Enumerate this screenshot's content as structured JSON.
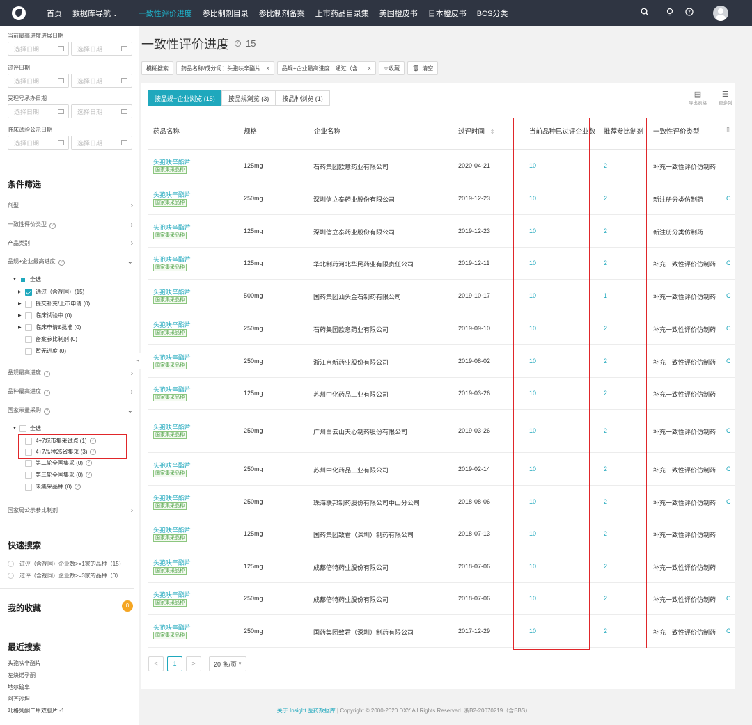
{
  "nav": {
    "items": [
      "首页",
      "数据库导航",
      "一致性评价进度",
      "参比制剂目录",
      "参比制剂备案",
      "上市药品目录集",
      "美国橙皮书",
      "日本橙皮书",
      "BCS分类"
    ],
    "active_index": 2,
    "dropdown_index": 1,
    "dropdown_caret": "⌄"
  },
  "sidebar": {
    "date_filters": [
      {
        "label": "当前最高进度进展日期",
        "start": "选择日期",
        "end": "选择日期"
      },
      {
        "label": "过评日期",
        "start": "选择日期",
        "end": "选择日期"
      },
      {
        "label": "受理号承办日期",
        "start": "选择日期",
        "end": "选择日期"
      },
      {
        "label": "临床试验公示日期",
        "start": "选择日期",
        "end": "选择日期"
      }
    ],
    "condition_title": "条件筛选",
    "filters": [
      {
        "label": "剂型"
      },
      {
        "label": "一致性评价类型"
      },
      {
        "label": "产品类别"
      },
      {
        "label": "品规+企业最高进度"
      }
    ],
    "progress_tree": {
      "all": "全选",
      "items": [
        "通过（含视同）(15)",
        "提交补充/上市申请 (0)",
        "临床试验中 (0)",
        "临床申请&批准 (0)",
        "备案参比制剂 (0)",
        "暂无进度 (0)"
      ]
    },
    "filters2": [
      {
        "label": "品规最高进度"
      },
      {
        "label": "品种最高进度"
      },
      {
        "label": "国家带量采购"
      }
    ],
    "procurement_tree": {
      "all": "全选",
      "items": [
        "4+7城市集采试点 (1)",
        "4+7品种25省集采 (3)",
        "第二轮全国集采 (0)",
        "第三轮全国集采 (0)",
        "未集采品种 (0)"
      ]
    },
    "filter_last": "国家局公示参比制剂",
    "quick_title": "快速搜索",
    "quick_items": [
      "过评（含视同）企业数>=1家的品种（15）",
      "过评（含视同）企业数>=3家的品种（0）"
    ],
    "fav_title": "我的收藏",
    "fav_count": "0",
    "recent_title": "最近搜索",
    "recent_items": [
      "头孢呋辛酯片",
      "左炔诺孕酮",
      "地尔硫卓",
      "阿齐沙坦",
      "吡格列酮二甲双胍片 -1"
    ]
  },
  "main": {
    "title": "一致性评价进度",
    "count": "15",
    "tags": {
      "fuzzy": "模糊搜索",
      "name": "药品名称/成分词：头孢呋辛酯片",
      "progress": "品规+企业最高进度：通过（含...",
      "save": "☆收藏",
      "clear": "清空"
    },
    "tabs": [
      "按品规+企业浏览 (15)",
      "按品规浏览 (3)",
      "按品种浏览 (1)"
    ],
    "tools": {
      "export": "导出表格",
      "more": "更多列"
    },
    "columns": [
      "药品名称",
      "规格",
      "企业名称",
      "过评时间",
      "当前品种已过评企业数",
      "推荐参比制剂",
      "一致性评价类型"
    ],
    "sort_icon": "⇕",
    "drug_tag": "国家集采品种",
    "rows": [
      {
        "name": "头孢呋辛酯片",
        "spec": "125mg",
        "company": "石药集团欧意药业有限公司",
        "date": "2020-04-21",
        "count": "10",
        "ref": "2",
        "type": "补充一致性评价仿制药"
      },
      {
        "name": "头孢呋辛酯片",
        "spec": "250mg",
        "company": "深圳信立泰药业股份有限公司",
        "date": "2019-12-23",
        "count": "10",
        "ref": "2",
        "type": "新注册分类仿制药"
      },
      {
        "name": "头孢呋辛酯片",
        "spec": "125mg",
        "company": "深圳信立泰药业股份有限公司",
        "date": "2019-12-23",
        "count": "10",
        "ref": "2",
        "type": "新注册分类仿制药"
      },
      {
        "name": "头孢呋辛酯片",
        "spec": "125mg",
        "company": "华北制药河北华民药业有限责任公司",
        "date": "2019-12-11",
        "count": "10",
        "ref": "2",
        "type": "补充一致性评价仿制药"
      },
      {
        "name": "头孢呋辛酯片",
        "spec": "500mg",
        "company": "国药集团汕头金石制药有限公司",
        "date": "2019-10-17",
        "count": "10",
        "ref": "1",
        "type": "补充一致性评价仿制药"
      },
      {
        "name": "头孢呋辛酯片",
        "spec": "250mg",
        "company": "石药集团欧意药业有限公司",
        "date": "2019-09-10",
        "count": "10",
        "ref": "2",
        "type": "补充一致性评价仿制药"
      },
      {
        "name": "头孢呋辛酯片",
        "spec": "250mg",
        "company": "浙江京新药业股份有限公司",
        "date": "2019-08-02",
        "count": "10",
        "ref": "2",
        "type": "补充一致性评价仿制药"
      },
      {
        "name": "头孢呋辛酯片",
        "spec": "125mg",
        "company": "苏州中化药品工业有限公司",
        "date": "2019-03-26",
        "count": "10",
        "ref": "2",
        "type": "补充一致性评价仿制药"
      },
      {
        "name": "头孢呋辛酯片",
        "spec": "250mg",
        "company": "广州白云山天心制药股份有限公司",
        "date": "2019-03-26",
        "count": "10",
        "ref": "2",
        "type": "补充一致性评价仿制药"
      },
      {
        "name": "头孢呋辛酯片",
        "spec": "250mg",
        "company": "苏州中化药品工业有限公司",
        "date": "2019-02-14",
        "count": "10",
        "ref": "2",
        "type": "补充一致性评价仿制药"
      },
      {
        "name": "头孢呋辛酯片",
        "spec": "250mg",
        "company": "珠海联邦制药股份有限公司中山分公司",
        "date": "2018-08-06",
        "count": "10",
        "ref": "2",
        "type": "补充一致性评价仿制药"
      },
      {
        "name": "头孢呋辛酯片",
        "spec": "125mg",
        "company": "国药集团致君（深圳）制药有限公司",
        "date": "2018-07-13",
        "count": "10",
        "ref": "2",
        "type": "补充一致性评价仿制药"
      },
      {
        "name": "头孢呋辛酯片",
        "spec": "125mg",
        "company": "成都倍特药业股份有限公司",
        "date": "2018-07-06",
        "count": "10",
        "ref": "2",
        "type": "补充一致性评价仿制药"
      },
      {
        "name": "头孢呋辛酯片",
        "spec": "250mg",
        "company": "成都倍特药业股份有限公司",
        "date": "2018-07-06",
        "count": "10",
        "ref": "2",
        "type": "补充一致性评价仿制药"
      },
      {
        "name": "头孢呋辛酯片",
        "spec": "250mg",
        "company": "国药集团致君（深圳）制药有限公司",
        "date": "2017-12-29",
        "count": "10",
        "ref": "2",
        "type": "补充一致性评价仿制药"
      }
    ],
    "pager": {
      "prev": "<",
      "page": "1",
      "next": ">",
      "size": "20 条/页"
    }
  },
  "footer": {
    "link": "关于 Insight 医药数据库",
    "copyright": "| Copyright © 2000-2020 DXY All Rights Reserved. 浙B2-20070219（含BBS）"
  },
  "colors": {
    "accent": "#1fa8bd",
    "highlight_box": "#e0262a",
    "nav_bg": "#2f3542"
  }
}
